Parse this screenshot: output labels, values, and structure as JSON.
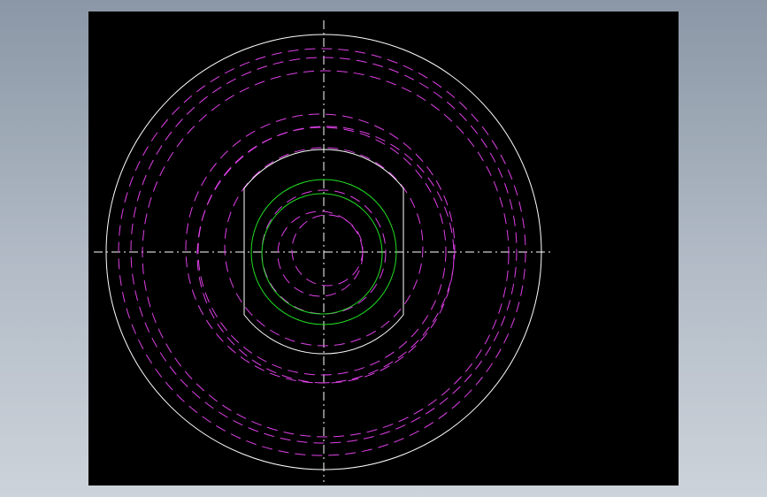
{
  "drawing": {
    "background": "#000000",
    "colors": {
      "outline": "#ffffff",
      "hidden_lines": "#e040e8",
      "center_lines": "#ffffff",
      "highlight_circle": "#22dd22"
    },
    "line_styles": {
      "outline": "solid",
      "hidden_lines": "dashed",
      "center_lines": "dash-dot",
      "highlight_circle": "solid"
    }
  }
}
